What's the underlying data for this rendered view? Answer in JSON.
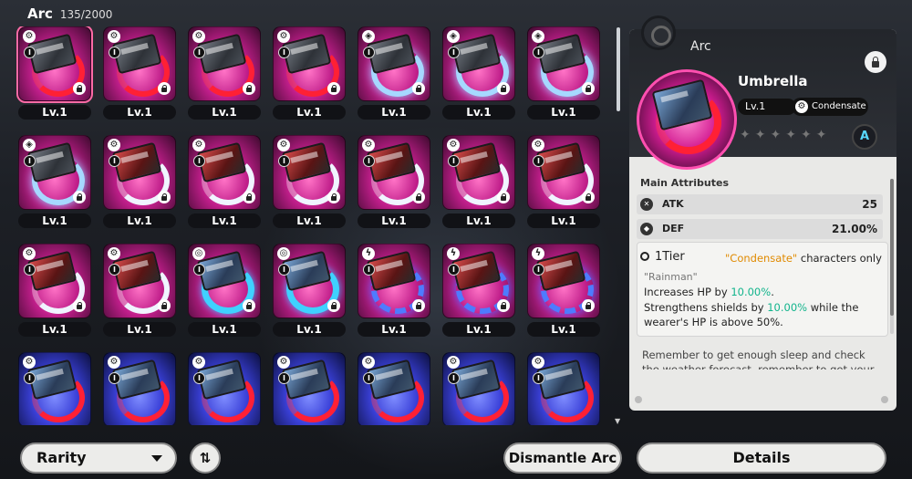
{
  "header": {
    "title": "Arc",
    "count": "135/2000"
  },
  "colors": {
    "pink_tile": "#c01e8a",
    "blue_tile": "#3a40d8",
    "selection": "#ff6aa6",
    "green_text": "#12b48c",
    "orange_text": "#e08a00"
  },
  "inventory": [
    {
      "rarity": "pink",
      "art": "red",
      "device": "a",
      "class_icon": "gear-icon",
      "tier": "I",
      "level": "Lv.1",
      "locked": true,
      "selected": true
    },
    {
      "rarity": "pink",
      "art": "red",
      "device": "a",
      "class_icon": "gear-icon",
      "tier": "I",
      "level": "Lv.1",
      "locked": true
    },
    {
      "rarity": "pink",
      "art": "red",
      "device": "a",
      "class_icon": "gear-icon",
      "tier": "I",
      "level": "Lv.1",
      "locked": true
    },
    {
      "rarity": "pink",
      "art": "red",
      "device": "a",
      "class_icon": "gear-icon",
      "tier": "I",
      "level": "Lv.1",
      "locked": true
    },
    {
      "rarity": "pink",
      "art": "iceb",
      "device": "a",
      "class_icon": "cube-icon",
      "tier": "I",
      "level": "Lv.1",
      "locked": true
    },
    {
      "rarity": "pink",
      "art": "iceb",
      "device": "a",
      "class_icon": "cube-icon",
      "tier": "I",
      "level": "Lv.1",
      "locked": true
    },
    {
      "rarity": "pink",
      "art": "iceb",
      "device": "a",
      "class_icon": "cube-icon",
      "tier": "I",
      "level": "Lv.1",
      "locked": true
    },
    {
      "rarity": "pink",
      "art": "iceb",
      "device": "a",
      "class_icon": "cube-icon",
      "tier": "I",
      "level": "Lv.1",
      "locked": true
    },
    {
      "rarity": "pink",
      "art": "white",
      "device": "b",
      "class_icon": "gear-icon",
      "tier": "I",
      "level": "Lv.1",
      "locked": true
    },
    {
      "rarity": "pink",
      "art": "white",
      "device": "b",
      "class_icon": "gear-icon",
      "tier": "I",
      "level": "Lv.1",
      "locked": true
    },
    {
      "rarity": "pink",
      "art": "white",
      "device": "b",
      "class_icon": "gear-icon",
      "tier": "I",
      "level": "Lv.1",
      "locked": true
    },
    {
      "rarity": "pink",
      "art": "white",
      "device": "b",
      "class_icon": "gear-icon",
      "tier": "I",
      "level": "Lv.1",
      "locked": true
    },
    {
      "rarity": "pink",
      "art": "white",
      "device": "b",
      "class_icon": "gear-icon",
      "tier": "I",
      "level": "Lv.1",
      "locked": true
    },
    {
      "rarity": "pink",
      "art": "white",
      "device": "b",
      "class_icon": "gear-icon",
      "tier": "I",
      "level": "Lv.1",
      "locked": true
    },
    {
      "rarity": "pink",
      "art": "white",
      "device": "b",
      "class_icon": "gear-icon",
      "tier": "I",
      "level": "Lv.1",
      "locked": true
    },
    {
      "rarity": "pink",
      "art": "white",
      "device": "b",
      "class_icon": "gear-icon",
      "tier": "I",
      "level": "Lv.1",
      "locked": true
    },
    {
      "rarity": "pink",
      "art": "cyan",
      "device": "c",
      "class_icon": "swirl-icon",
      "tier": "I",
      "level": "Lv.1",
      "locked": true
    },
    {
      "rarity": "pink",
      "art": "cyan",
      "device": "c",
      "class_icon": "swirl-icon",
      "tier": "I",
      "level": "Lv.1",
      "locked": true
    },
    {
      "rarity": "pink",
      "art": "bolt",
      "device": "b",
      "class_icon": "bolt-icon",
      "tier": "I",
      "level": "Lv.1",
      "locked": true
    },
    {
      "rarity": "pink",
      "art": "bolt",
      "device": "b",
      "class_icon": "bolt-icon",
      "tier": "I",
      "level": "Lv.1",
      "locked": true
    },
    {
      "rarity": "pink",
      "art": "bolt",
      "device": "b",
      "class_icon": "bolt-icon",
      "tier": "I",
      "level": "Lv.1",
      "locked": true
    },
    {
      "rarity": "blue",
      "art": "red",
      "device": "c",
      "class_icon": "gear-icon",
      "tier": "I",
      "level": "Lv.1",
      "locked": false
    },
    {
      "rarity": "blue",
      "art": "red",
      "device": "c",
      "class_icon": "gear-icon",
      "tier": "I",
      "level": "Lv.1",
      "locked": false
    },
    {
      "rarity": "blue",
      "art": "red",
      "device": "c",
      "class_icon": "gear-icon",
      "tier": "I",
      "level": "Lv.1",
      "locked": false
    },
    {
      "rarity": "blue",
      "art": "red",
      "device": "c",
      "class_icon": "gear-icon",
      "tier": "I",
      "level": "Lv.1",
      "locked": false
    },
    {
      "rarity": "blue",
      "art": "red",
      "device": "c",
      "class_icon": "gear-icon",
      "tier": "I",
      "level": "Lv.1",
      "locked": false
    },
    {
      "rarity": "blue",
      "art": "red",
      "device": "c",
      "class_icon": "gear-icon",
      "tier": "I",
      "level": "Lv.1",
      "locked": false
    },
    {
      "rarity": "blue",
      "art": "red",
      "device": "c",
      "class_icon": "gear-icon",
      "tier": "I",
      "level": "Lv.1",
      "locked": false
    }
  ],
  "detail": {
    "panel_title": "Arc",
    "name": "Umbrella",
    "level": "Lv.1",
    "class_label": "Condensate",
    "stars_total": 6,
    "attributes_title": "Main Attributes",
    "attributes": [
      {
        "name": "ATK",
        "value": "25",
        "icon": "crossed-swords-icon"
      },
      {
        "name": "DEF",
        "value": "21.00%",
        "icon": "shield-icon"
      }
    ],
    "tier": "1Tier",
    "condition_pre": "\"Condensate\"",
    "condition_post": " characters only",
    "effect_name": "\"Rainman\"",
    "effect_line1_pre": "Increases HP by ",
    "effect_line1_val": "10.00%",
    "effect_line1_post": ".",
    "effect_line2_pre": "Strengthens shields by ",
    "effect_line2_val": "10.00%",
    "effect_line2_post": " while the",
    "effect_line3": "wearer's HP is above 50%.",
    "description": "Remember to get enough sleep and check the weather forecast, remember to get your"
  },
  "controls": {
    "sort_label": "Rarity",
    "sort_order_glyph": "⇅",
    "dismantle_label": "Dismantle Arc",
    "details_label": "Details"
  }
}
